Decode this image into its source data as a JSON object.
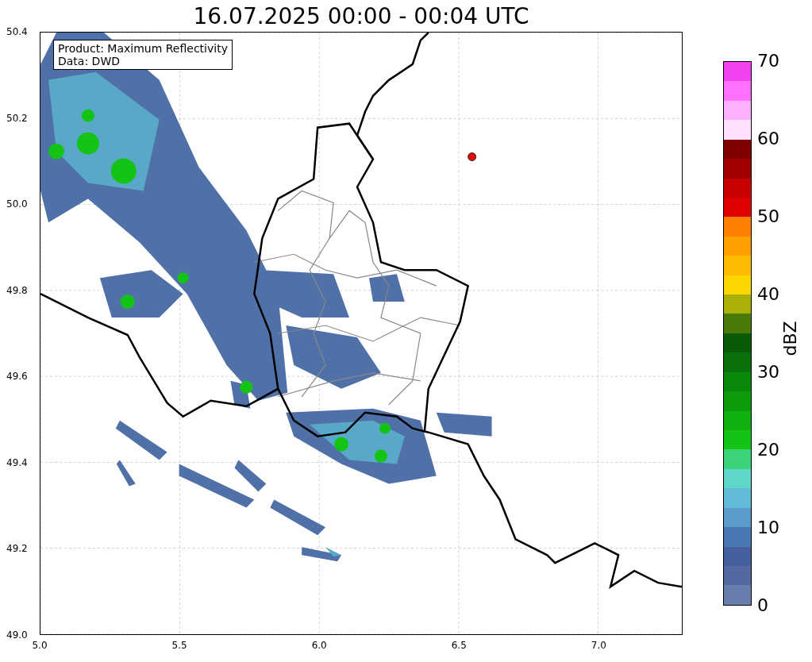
{
  "title": "16.07.2025 00:00 - 00:04 UTC",
  "info_box": [
    "Product: Maximum Reflectivity",
    "Data: DWD"
  ],
  "axes": {
    "xticks": [
      "5.0",
      "5.5",
      "6.0",
      "6.5",
      "7.0"
    ],
    "yticks": [
      "50.4",
      "50.2",
      "50.0",
      "49.8",
      "49.6",
      "49.4",
      "49.2",
      "49.0"
    ]
  },
  "colorbar": {
    "label": "dBZ",
    "ticks": [
      "70",
      "60",
      "50",
      "40",
      "30",
      "20",
      "10",
      "0"
    ],
    "steps": [
      {
        "color": "#f040f0"
      },
      {
        "color": "#ff70ff"
      },
      {
        "color": "#ffb0ff"
      },
      {
        "color": "#ffe0ff"
      },
      {
        "color": "#800000"
      },
      {
        "color": "#a00000"
      },
      {
        "color": "#c80000"
      },
      {
        "color": "#e00000"
      },
      {
        "color": "#ff8000"
      },
      {
        "color": "#ffa000"
      },
      {
        "color": "#ffbb00"
      },
      {
        "color": "#ffd700"
      },
      {
        "color": "#aab00a"
      },
      {
        "color": "#4a7a0a"
      },
      {
        "color": "#0a5a0a"
      },
      {
        "color": "#0a700a"
      },
      {
        "color": "#0a880a"
      },
      {
        "color": "#0c9c0c"
      },
      {
        "color": "#10b010"
      },
      {
        "color": "#14c414"
      },
      {
        "color": "#3cd478"
      },
      {
        "color": "#60d8c8"
      },
      {
        "color": "#62bcd8"
      },
      {
        "color": "#5a9cc8"
      },
      {
        "color": "#4a78b4"
      },
      {
        "color": "#4460a0"
      },
      {
        "color": "#5568a0"
      },
      {
        "color": "#6a7eae"
      }
    ]
  }
}
